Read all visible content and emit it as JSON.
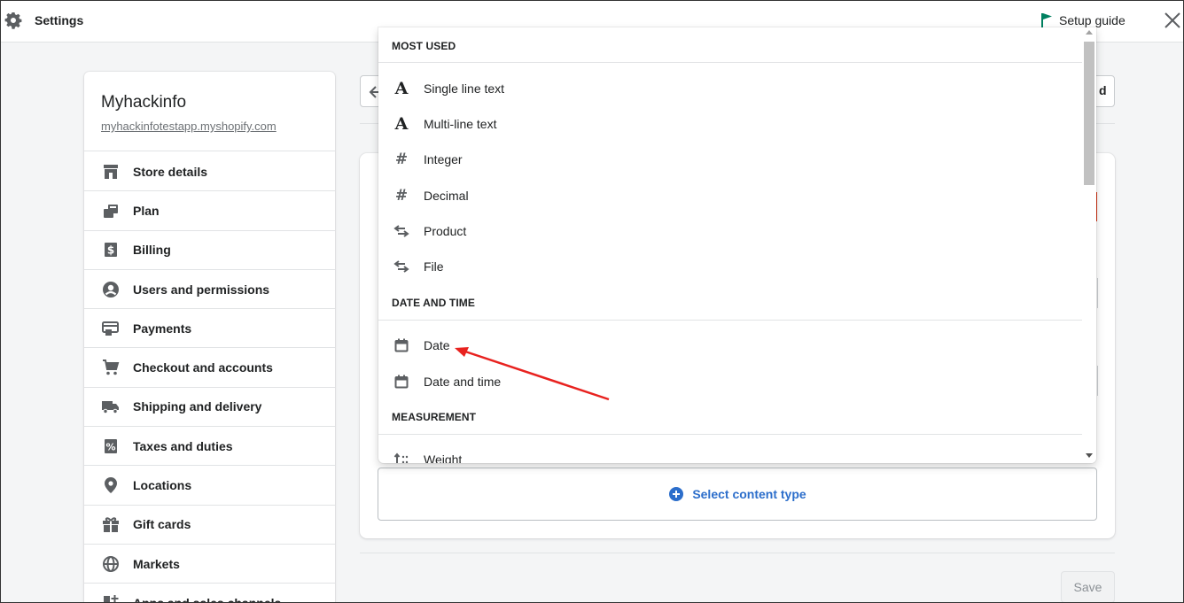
{
  "topbar": {
    "title": "Settings",
    "setup_guide_label": "Setup guide",
    "flag_color": "#008060"
  },
  "store": {
    "name": "Myhackinfo",
    "url": "myhackinfotestapp.myshopify.com"
  },
  "sidebar": {
    "items": [
      {
        "label": "Store details",
        "icon": "store-icon"
      },
      {
        "label": "Plan",
        "icon": "plan-icon"
      },
      {
        "label": "Billing",
        "icon": "billing-icon"
      },
      {
        "label": "Users and permissions",
        "icon": "user-icon"
      },
      {
        "label": "Payments",
        "icon": "payments-icon"
      },
      {
        "label": "Checkout and accounts",
        "icon": "cart-icon"
      },
      {
        "label": "Shipping and delivery",
        "icon": "truck-icon"
      },
      {
        "label": "Taxes and duties",
        "icon": "tax-icon"
      },
      {
        "label": "Locations",
        "icon": "location-pin-icon"
      },
      {
        "label": "Gift cards",
        "icon": "gift-icon"
      },
      {
        "label": "Markets",
        "icon": "globe-icon"
      },
      {
        "label": "Apps and sales channels",
        "icon": "apps-icon"
      }
    ]
  },
  "header": {
    "right_button_label": "d"
  },
  "dropdown": {
    "sections": [
      {
        "title": "MOST USED",
        "options": [
          {
            "label": "Single line text",
            "icon": "text-a-icon"
          },
          {
            "label": "Multi-line text",
            "icon": "text-a-icon"
          },
          {
            "label": "Integer",
            "icon": "hash-icon"
          },
          {
            "label": "Decimal",
            "icon": "hash-icon"
          },
          {
            "label": "Product",
            "icon": "reference-arrows-icon"
          },
          {
            "label": "File",
            "icon": "reference-arrows-icon"
          }
        ]
      },
      {
        "title": "DATE AND TIME",
        "options": [
          {
            "label": "Date",
            "icon": "calendar-icon"
          },
          {
            "label": "Date and time",
            "icon": "calendar-icon"
          }
        ]
      },
      {
        "title": "MEASUREMENT",
        "options": [
          {
            "label": "Weight",
            "icon": "weight-icon"
          }
        ]
      }
    ]
  },
  "content_type": {
    "select_label": "Select content type"
  },
  "footer": {
    "save_label": "Save"
  },
  "annotation": {
    "arrow_color": "#e8221f"
  }
}
